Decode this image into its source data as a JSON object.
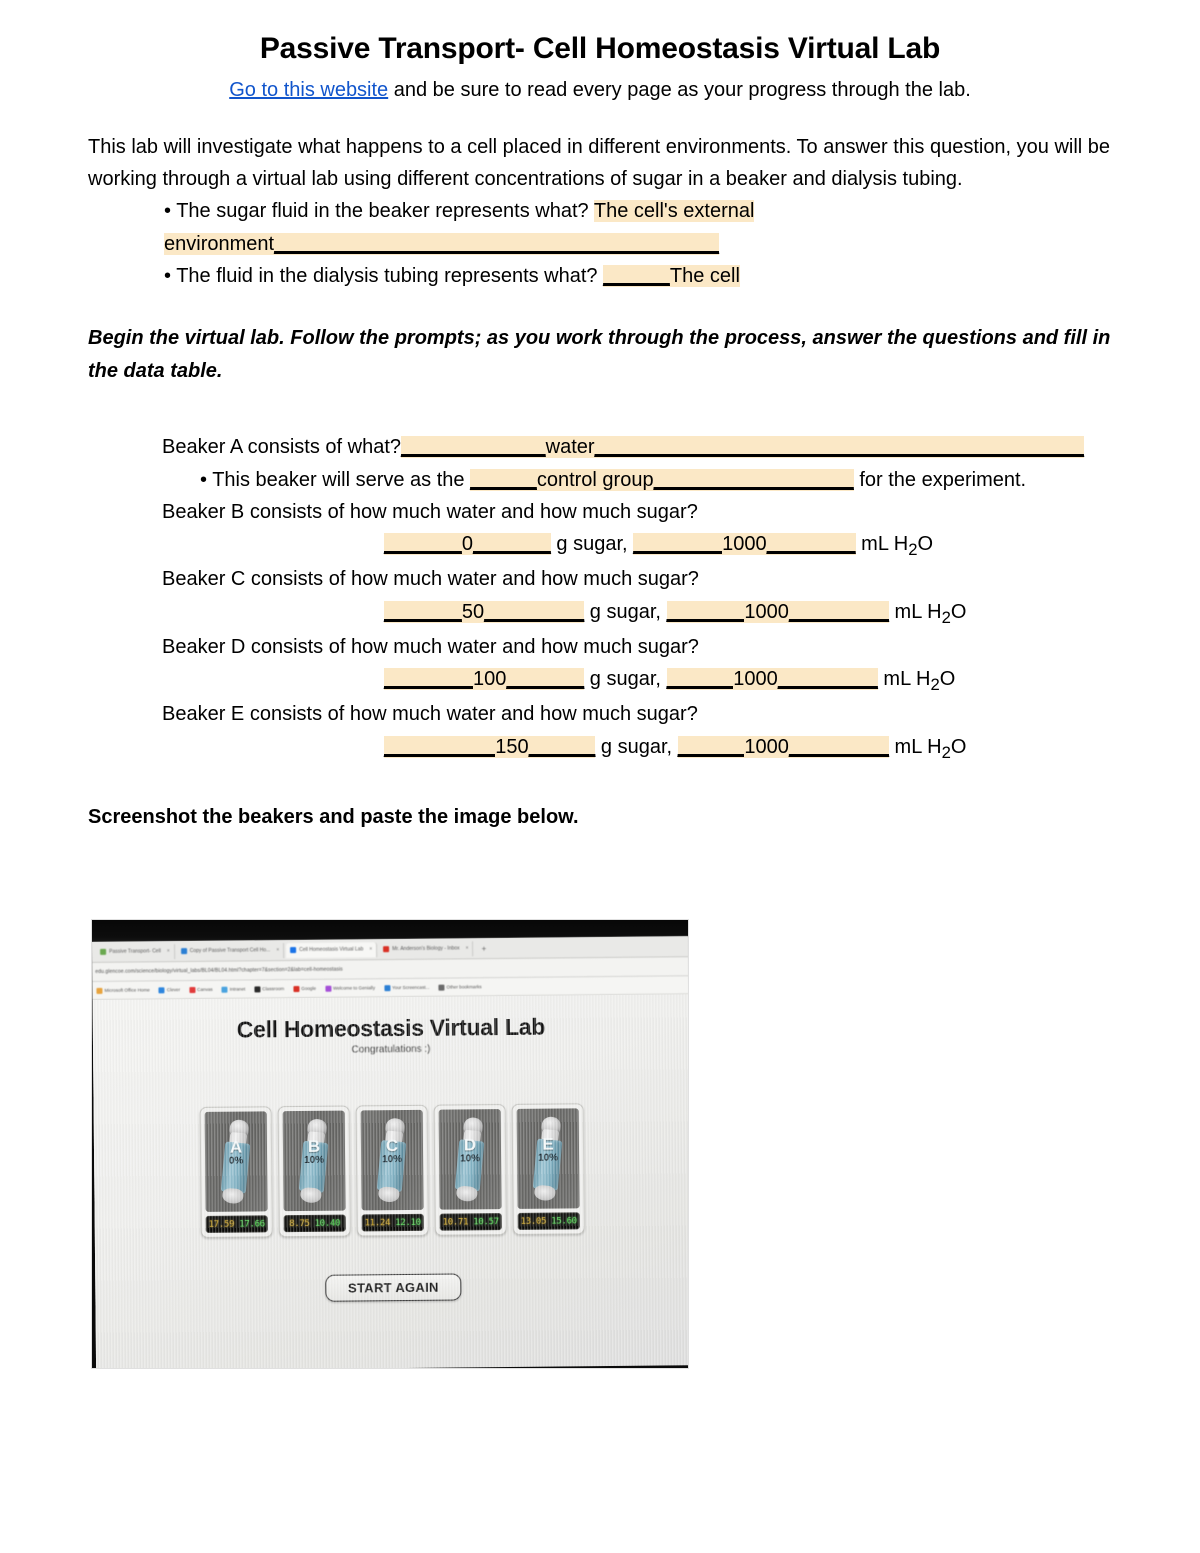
{
  "document": {
    "title": "Passive Transport- Cell Homeostasis Virtual Lab",
    "link_text": "Go to this website",
    "subtitle_rest": " and be sure to read every page as your progress through the lab.",
    "link_color": "#1155cc",
    "highlight_color": "#fbe8c6"
  },
  "intro": {
    "paragraph": "This lab will investigate what happens to a cell placed in different environments. To answer this question, you will be working through a virtual lab using different concentrations of sugar in a beaker and dialysis tubing.",
    "questions": [
      {
        "prompt": "• The sugar fluid in the beaker represents what? ",
        "answer": "The cell's external environment",
        "trailing_blank": "________________________________________"
      },
      {
        "prompt": "• The fluid in the dialysis tubing represents what? ",
        "leading_blank": "______",
        "answer": "The cell"
      }
    ]
  },
  "instruction": "Begin the virtual lab. Follow the prompts; as you work through the process, answer the questions and fill in the data table.",
  "beakers": {
    "a": {
      "question": "Beaker A consists of what?",
      "leading_blank": "_____________",
      "answer": "water",
      "trailing_blank": "____________________________________________",
      "sub_prompt": "• This beaker will serve as the ",
      "sub_leading_blank": "______",
      "sub_answer": "control group",
      "sub_trailing_blank": "__________________",
      "sub_tail": " for the experiment."
    },
    "b": {
      "question": "Beaker B consists of how much water and how much sugar?",
      "sugar_blank_lead": "_______",
      "sugar": "0",
      "sugar_blank_trail": "_______",
      "sugar_unit": " g sugar, ",
      "water_blank_lead": "________",
      "water": "1000",
      "water_blank_trail": "________",
      "water_unit": " mL H"
    },
    "c": {
      "question": "Beaker C consists of how much water and how much sugar?",
      "sugar_blank_lead": "_______",
      "sugar": "50",
      "sugar_blank_trail": "_________",
      "sugar_unit": " g sugar, ",
      "water_blank_lead": "_______",
      "water": "1000",
      "water_blank_trail": "_________",
      "water_unit": " mL H"
    },
    "d": {
      "question": "Beaker D consists of how much water and how much sugar?",
      "sugar_blank_lead": "________",
      "sugar": "100",
      "sugar_blank_trail": "_______",
      "sugar_unit": " g sugar, ",
      "water_blank_lead": "______",
      "water": "1000",
      "water_blank_trail": "_________",
      "water_unit": " mL H"
    },
    "e": {
      "question": "Beaker E consists of how much water and how much sugar?",
      "sugar_blank_lead": "__________",
      "sugar": "150",
      "sugar_blank_trail": "______",
      "sugar_unit": " g sugar, ",
      "water_blank_lead": "______",
      "water": "1000",
      "water_blank_trail": "_________",
      "water_unit": " mL H"
    },
    "subscript": "2",
    "water_suffix": "O"
  },
  "screenshot_instruction": "Screenshot the beakers and paste the image below.",
  "photo": {
    "browser": {
      "tabs": [
        {
          "label": "Passive Transport- Cell",
          "favicon_color": "#6aa84f"
        },
        {
          "label": "Copy of Passive Transport Cell Ho...",
          "favicon_color": "#2b7fd4"
        },
        {
          "label": "Cell Homeostasis Virtual Lab",
          "favicon_color": "#1a73e8"
        },
        {
          "label": "Mr. Anderson's Biology - Inbox",
          "favicon_color": "#d93025"
        }
      ],
      "new_tab_label": "+",
      "close_label": "×",
      "url": "edu.glencoe.com/science/biology/virtual_labs/BL04/BL04.html?chapter=7&section=2&lab=cell-homeostasis",
      "bookmarks": [
        {
          "label": "Microsoft Office Home",
          "color": "#e8a33d"
        },
        {
          "label": "Clever",
          "color": "#2e86de"
        },
        {
          "label": "Canvas",
          "color": "#e13a3a"
        },
        {
          "label": "Intranet",
          "color": "#4aa3df"
        },
        {
          "label": "Classroom",
          "color": "#2a2a2a"
        },
        {
          "label": "Google",
          "color": "#d93025"
        },
        {
          "label": "Welcome to Genially",
          "color": "#a54fd8"
        },
        {
          "label": "Your Screencast...",
          "color": "#2b7fd4"
        },
        {
          "label": "Other bookmarks",
          "color": "#6b6b6b"
        }
      ]
    },
    "app": {
      "title": "Cell Homeostasis Virtual Lab",
      "subtitle": "Congratulations :)",
      "start_again_label": "START AGAIN",
      "beakers": [
        {
          "letter": "A",
          "percent": "0%",
          "readout_left": "17.59",
          "readout_right": "17.66"
        },
        {
          "letter": "B",
          "percent": "10%",
          "readout_left": "8.75",
          "readout_right": "10.40"
        },
        {
          "letter": "C",
          "percent": "10%",
          "readout_left": "11.24",
          "readout_right": "12.10"
        },
        {
          "letter": "D",
          "percent": "10%",
          "readout_left": "10.71",
          "readout_right": "10.57"
        },
        {
          "letter": "E",
          "percent": "10%",
          "readout_left": "13.05",
          "readout_right": "15.60"
        }
      ]
    }
  }
}
